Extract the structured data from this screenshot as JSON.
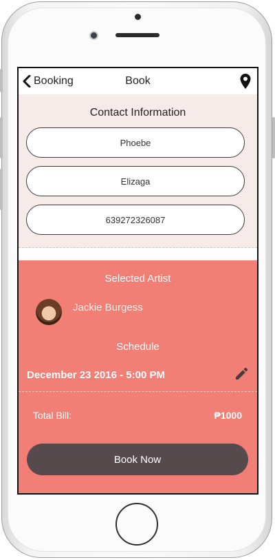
{
  "navbar": {
    "back_label": "Booking",
    "title": "Book"
  },
  "contact": {
    "title": "Contact Information",
    "first_name": "Phoebe",
    "last_name": "Elizaga",
    "phone": "639272326087"
  },
  "artist": {
    "section_label": "Selected Artist",
    "name": "Jackie Burgess"
  },
  "schedule": {
    "section_label": "Schedule",
    "datetime": "December 23 2016 -  5:00 PM"
  },
  "bill": {
    "label": "Total Bill:",
    "amount": "₱1000"
  },
  "actions": {
    "book_label": "Book Now"
  },
  "colors": {
    "accent": "#f17f75",
    "contact_bg": "#f6ebe9",
    "button_dark": "#574a4c"
  },
  "icons": [
    "chevron-left-icon",
    "location-pin-icon",
    "pencil-icon"
  ]
}
